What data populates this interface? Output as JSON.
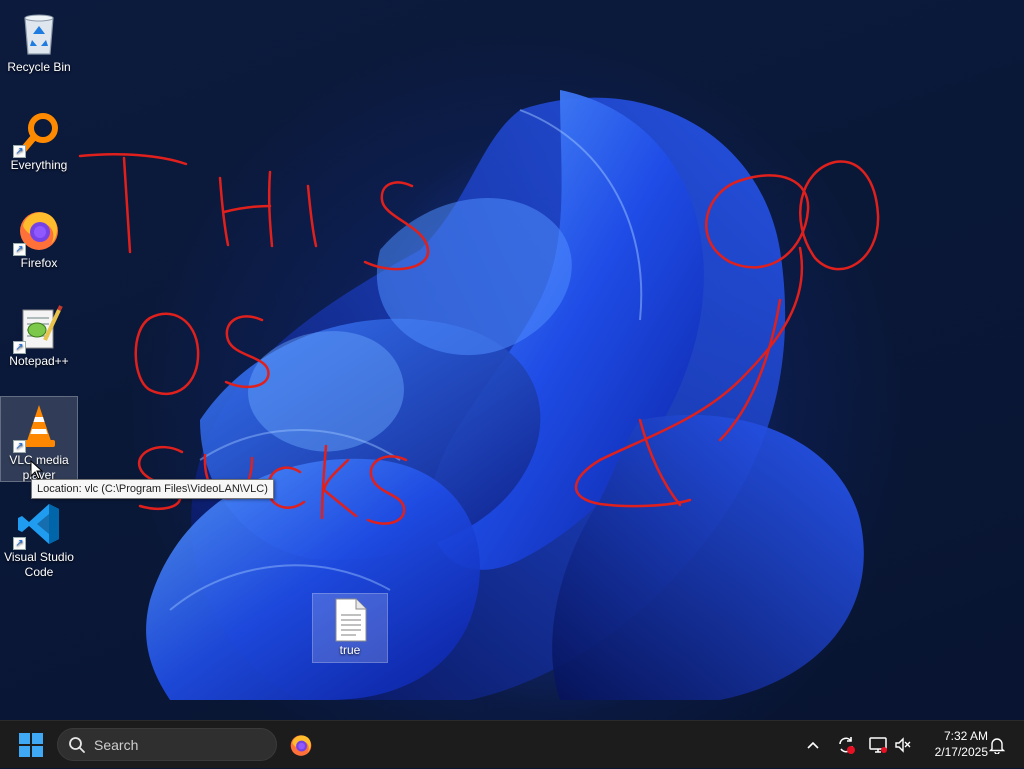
{
  "desktop": {
    "icons": [
      {
        "label": "Recycle Bin",
        "icon": "recycle-bin-icon"
      },
      {
        "label": "Everything",
        "icon": "everything-search-icon"
      },
      {
        "label": "Firefox",
        "icon": "firefox-icon"
      },
      {
        "label": "Notepad++",
        "icon": "notepadpp-icon"
      },
      {
        "label": "VLC media player",
        "icon": "vlc-icon"
      },
      {
        "label": "Visual Studio Code",
        "icon": "vscode-icon"
      }
    ],
    "file": {
      "label": "true",
      "icon": "text-file-icon"
    },
    "tooltip": "Location: vlc (C:\\Program Files\\VideoLAN\\VLC)",
    "scribble_color": "#e0201c"
  },
  "taskbar": {
    "search_placeholder": "Search",
    "pinned": [
      {
        "name": "Firefox",
        "icon": "firefox-icon"
      }
    ],
    "tray_icons": [
      "chevron-up-icon",
      "sync-icon",
      "network-icon",
      "speaker-muted-icon",
      "notification-bell-icon"
    ],
    "time": "7:32 AM",
    "date": "2/17/2025"
  },
  "colors": {
    "taskbar": "#1c1c1c",
    "accent_blue": "#1a6cd8"
  }
}
